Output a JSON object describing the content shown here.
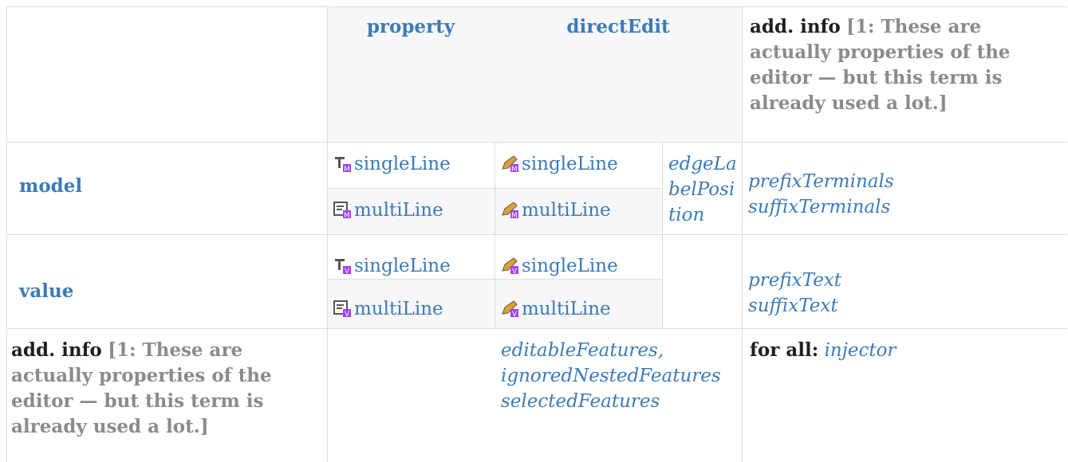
{
  "colors": {
    "link": "#3a7bb8",
    "note": "#8b8b8b",
    "border": "#dcdcdc",
    "shade": "#f7f7f7"
  },
  "header": {
    "property": "property",
    "directEdit": "directEdit",
    "addinfo_label": "add. info",
    "addinfo_note": "[1: These are actually properties of the editor — but this term is already used a lot.]"
  },
  "rows": {
    "model": {
      "label": "model",
      "property_single": "singleLine",
      "property_multi": "multiLine",
      "direct_single": "singleLine",
      "direct_multi": "multiLine",
      "edge": "edgeLabelPosition",
      "info1": "prefixTerminals",
      "info2": "suffixTerminals"
    },
    "value": {
      "label": "value",
      "property_single": "singleLine",
      "property_multi": "multiLine",
      "direct_single": "singleLine",
      "direct_multi": "multiLine",
      "info1": "prefixText",
      "info2": "suffixText"
    },
    "addinfo": {
      "label": "add. info",
      "note": "[1: These are actually properties of the editor — but this term is already used a lot.]",
      "direct1": "editableFeatures,",
      "direct2": "ignoredNestedFeatures",
      "direct3": "selectedFeatures",
      "forall_label": "for all:",
      "forall_value": "injector"
    }
  },
  "icons": {
    "property_model_single": "text-property-icon-model",
    "property_model_multi": "textarea-property-icon-model",
    "direct_model_single": "pencil-edit-icon-model",
    "direct_model_multi": "pencil-edit-icon-model",
    "property_value_single": "text-property-icon-value",
    "property_value_multi": "textarea-property-icon-value",
    "direct_value_single": "pencil-edit-icon-value",
    "direct_value_multi": "pencil-edit-icon-value"
  }
}
